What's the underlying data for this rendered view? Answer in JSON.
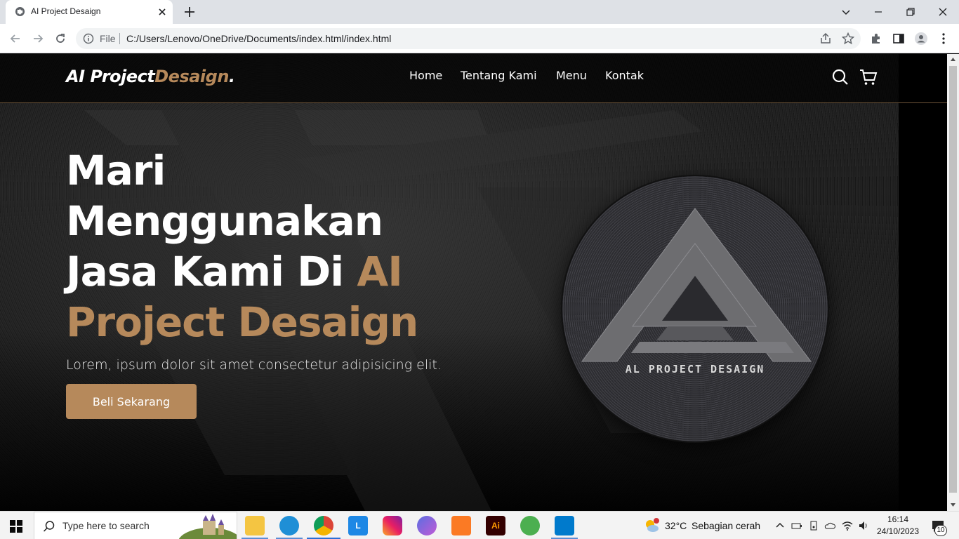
{
  "browser": {
    "tab_title": "AI Project Desaign",
    "omnibox_scheme": "File",
    "url": "C:/Users/Lenovo/OneDrive/Documents/index.html/index.html"
  },
  "site": {
    "brand_part1": "AI Project",
    "brand_part2": "Desaign",
    "brand_dot": ".",
    "nav": [
      {
        "label": "Home"
      },
      {
        "label": "Tentang Kami"
      },
      {
        "label": "Menu"
      },
      {
        "label": "Kontak"
      }
    ],
    "hero": {
      "title_white": "Mari Menggunakan Jasa Kami Di ",
      "title_gold": "AI Project Desaign",
      "subtitle": "Lorem, ipsum dolor sit amet consectetur adipisicing elit.",
      "cta_label": "Beli Sekarang"
    },
    "logo_text": "AL PROJECT DESAIGN",
    "colors": {
      "accent": "#b6895b",
      "nav_bg": "#000000",
      "cta_bg": "#b6895b"
    }
  },
  "taskbar": {
    "search_placeholder": "Type here to search",
    "weather_temp": "32°C",
    "weather_desc": "Sebagian cerah",
    "weather_badge": "1",
    "clock_time": "16:14",
    "clock_date": "24/10/2023",
    "notification_count": "10",
    "apps": [
      "file-explorer",
      "edge",
      "chrome",
      "l-app",
      "instagram",
      "copilot",
      "xampp",
      "illustrator",
      "app-green",
      "vscode"
    ]
  }
}
